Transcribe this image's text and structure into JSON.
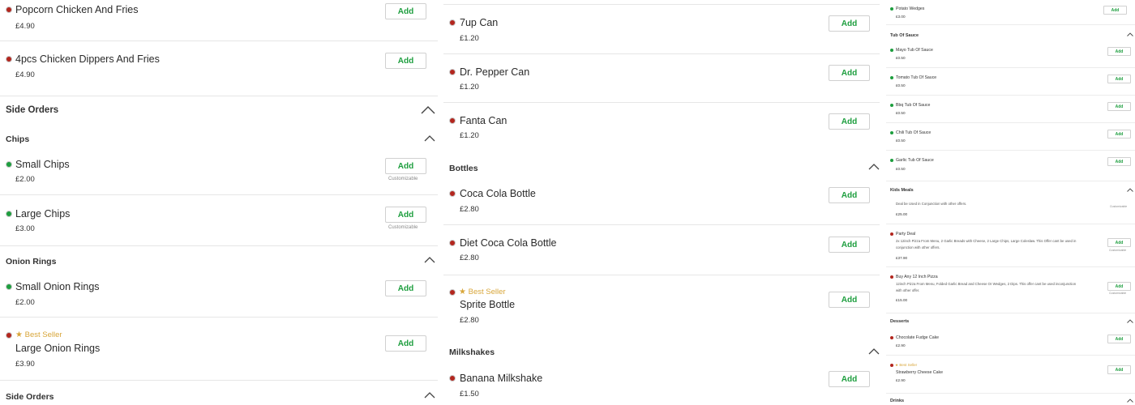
{
  "labels": {
    "add": "Add",
    "customizable": "Customizable",
    "best_seller": "Best Seller",
    "star": "★"
  },
  "colors": {
    "veg": "#1d9e3e",
    "non_veg": "#b3261e",
    "accent": "#1d9e3e",
    "best_seller": "#d8a63a"
  },
  "col1": {
    "items": [
      {
        "name": "Popcorn Chicken And Fries",
        "price": "£4.90"
      },
      {
        "name": "4pcs Chicken Dippers And Fries",
        "price": "£4.90"
      }
    ],
    "section_side_orders": "Side Orders",
    "sub_chips": "Chips",
    "chips_items": [
      {
        "name": "Small Chips",
        "price": "£2.00"
      },
      {
        "name": "Large Chips",
        "price": "£3.00"
      }
    ],
    "sub_onion_rings": "Onion Rings",
    "onion_items": [
      {
        "name": "Small Onion Rings",
        "price": "£2.00"
      },
      {
        "name": "Large Onion Rings",
        "price": "£3.90"
      }
    ],
    "sub_side_orders": "Side Orders"
  },
  "col2": {
    "items": [
      {
        "name": "7up Can",
        "price": "£1.20"
      },
      {
        "name": "Dr. Pepper Can",
        "price": "£1.20"
      },
      {
        "name": "Fanta Can",
        "price": "£1.20"
      }
    ],
    "sub_bottles": "Bottles",
    "bottle_items": [
      {
        "name": "Coca Cola Bottle",
        "price": "£2.80"
      },
      {
        "name": "Diet Coca Cola Bottle",
        "price": "£2.80"
      },
      {
        "name": "Sprite Bottle",
        "price": "£2.80"
      }
    ],
    "sub_milkshakes": "Milkshakes",
    "milkshake_items": [
      {
        "name": "Banana Milkshake",
        "price": "£1.50"
      }
    ]
  },
  "col3": {
    "potato": {
      "name": "Potato Wedges",
      "price": "£3.00"
    },
    "sub_tub": "Tub Of Sauce",
    "tub_items": [
      {
        "name": "Mayo Tub Of Sauce",
        "price": "£0.50"
      },
      {
        "name": "Tomato Tub Of Sauce",
        "price": "£0.50"
      },
      {
        "name": "Bbq Tub Of Sauce",
        "price": "£0.50"
      },
      {
        "name": "Chili Tub Of Sauce",
        "price": "£0.50"
      },
      {
        "name": "Garlic Tub Of Sauce",
        "price": "£0.50"
      }
    ],
    "sub_kids": "Kids Meals",
    "kids_partial_desc": "Deal be Used in Conjunction with other offers.",
    "kids_partial_price": "£25.00",
    "party": {
      "name": "Party Deal",
      "desc": "2x 12inch Pizza From Menu, 2 Garlic Breads with Cheese, 2 Large Chips, Large Coleslaw. This Offer cant be used in conjunction with other offers.",
      "price": "£37.90"
    },
    "buyany": {
      "name": "Buy Any 12 Inch Pizza",
      "desc": "12inch Pizza From Menu, Folded Garlic Bread and Cheese Or Wedges, 2 Dips. This offer cant be used inconjunction with other offer.",
      "price": "£15.00"
    },
    "sub_desserts": "Desserts",
    "dessert_items": [
      {
        "name": "Chocolate Fudge Cake",
        "price": "£2.90"
      },
      {
        "name": "Strawberry Cheese Cake",
        "price": "£2.90"
      }
    ],
    "sub_drinks": "Drinks"
  }
}
